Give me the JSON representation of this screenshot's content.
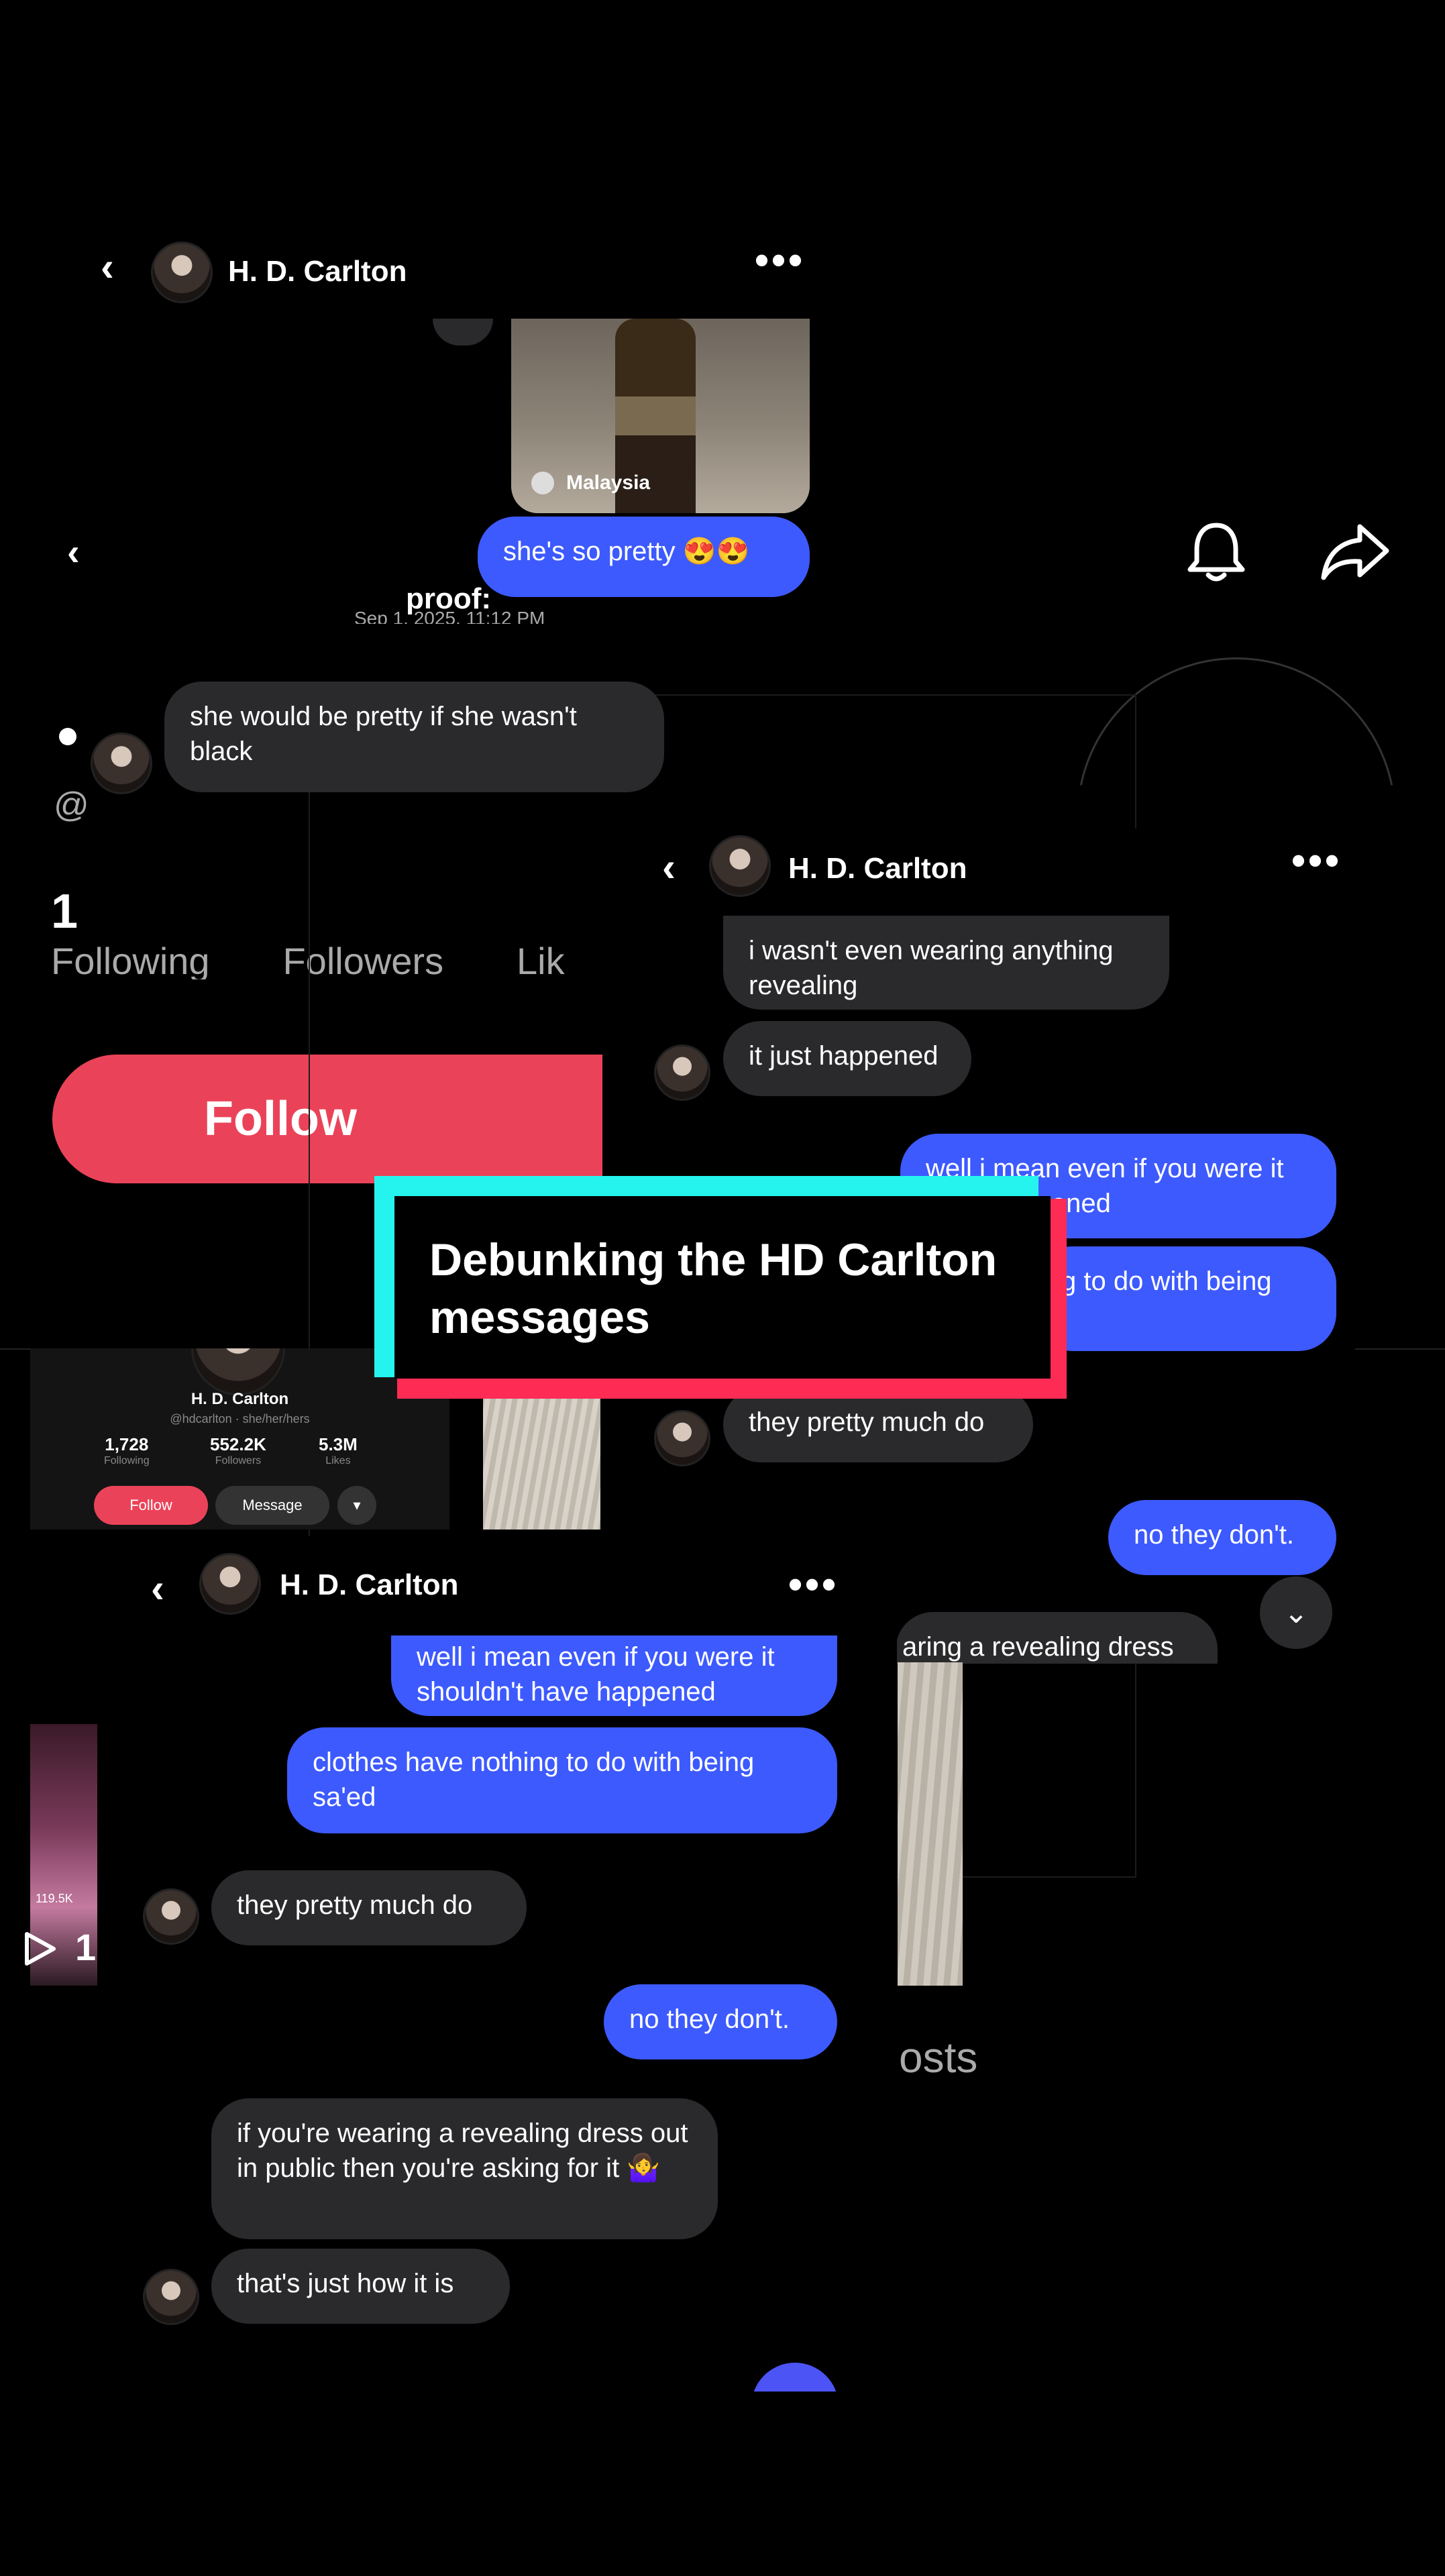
{
  "top_dm": {
    "contact_name": "H. D. Carlton",
    "media_location": "Malaysia",
    "sent_message": "she's so pretty 😍😍",
    "caption": "proof:",
    "timestamp": "Sep 1, 2025, 11:12 PM",
    "received_message": "she would be pretty if she wasn't black"
  },
  "profile_bg": {
    "at_symbol": "@",
    "following_count": "1",
    "stats_labels": "Following       Followers       Lik",
    "follow_label": "Follow",
    "posts_label": "osts",
    "video_views": "119.5K",
    "play_count": "1",
    "mini_profile": {
      "name": "H. D. Carlton",
      "handle": "@hdcarlton · she/her/hers",
      "following": "1,728",
      "following_label": "Following",
      "followers": "552.2K",
      "followers_label": "Followers",
      "likes": "5.3M",
      "likes_label": "Likes",
      "follow_btn": "Follow",
      "message_btn": "Message",
      "dropdown": "▾"
    }
  },
  "middle_dm": {
    "contact_name": "H. D. Carlton",
    "messages": [
      {
        "dir": "in",
        "text": "i wasn't even wearing anything revealing"
      },
      {
        "dir": "in",
        "text": "it just happened"
      },
      {
        "dir": "out",
        "text": "well i mean even if you were it have happened"
      },
      {
        "dir": "out",
        "text": "g to do with being"
      },
      {
        "dir": "in",
        "text": "they pretty much do"
      },
      {
        "dir": "out",
        "text": "no they don't."
      },
      {
        "dir": "in",
        "text": "aring a revealing dress"
      }
    ]
  },
  "bottom_dm": {
    "contact_name": "H. D. Carlton",
    "messages": [
      {
        "dir": "out",
        "text": "well i mean even if you were it shouldn't have happened"
      },
      {
        "dir": "out",
        "text": "clothes have nothing to do with being sa'ed"
      },
      {
        "dir": "in",
        "text": "they pretty much do"
      },
      {
        "dir": "out",
        "text": "no they don't."
      },
      {
        "dir": "in",
        "text": "if you're wearing a revealing dress out in public then you're asking for it 🤷‍♀️"
      },
      {
        "dir": "in",
        "text": "that's just how it is"
      }
    ]
  },
  "title_card": {
    "text": "Debunking the HD Carlton messages",
    "accent_cyan": "#25f4ee",
    "accent_red": "#fe2c55"
  },
  "colors": {
    "outgoing_bubble": "#3d5afe",
    "incoming_bubble": "#2a2a2c",
    "follow_button": "#ea4359"
  }
}
